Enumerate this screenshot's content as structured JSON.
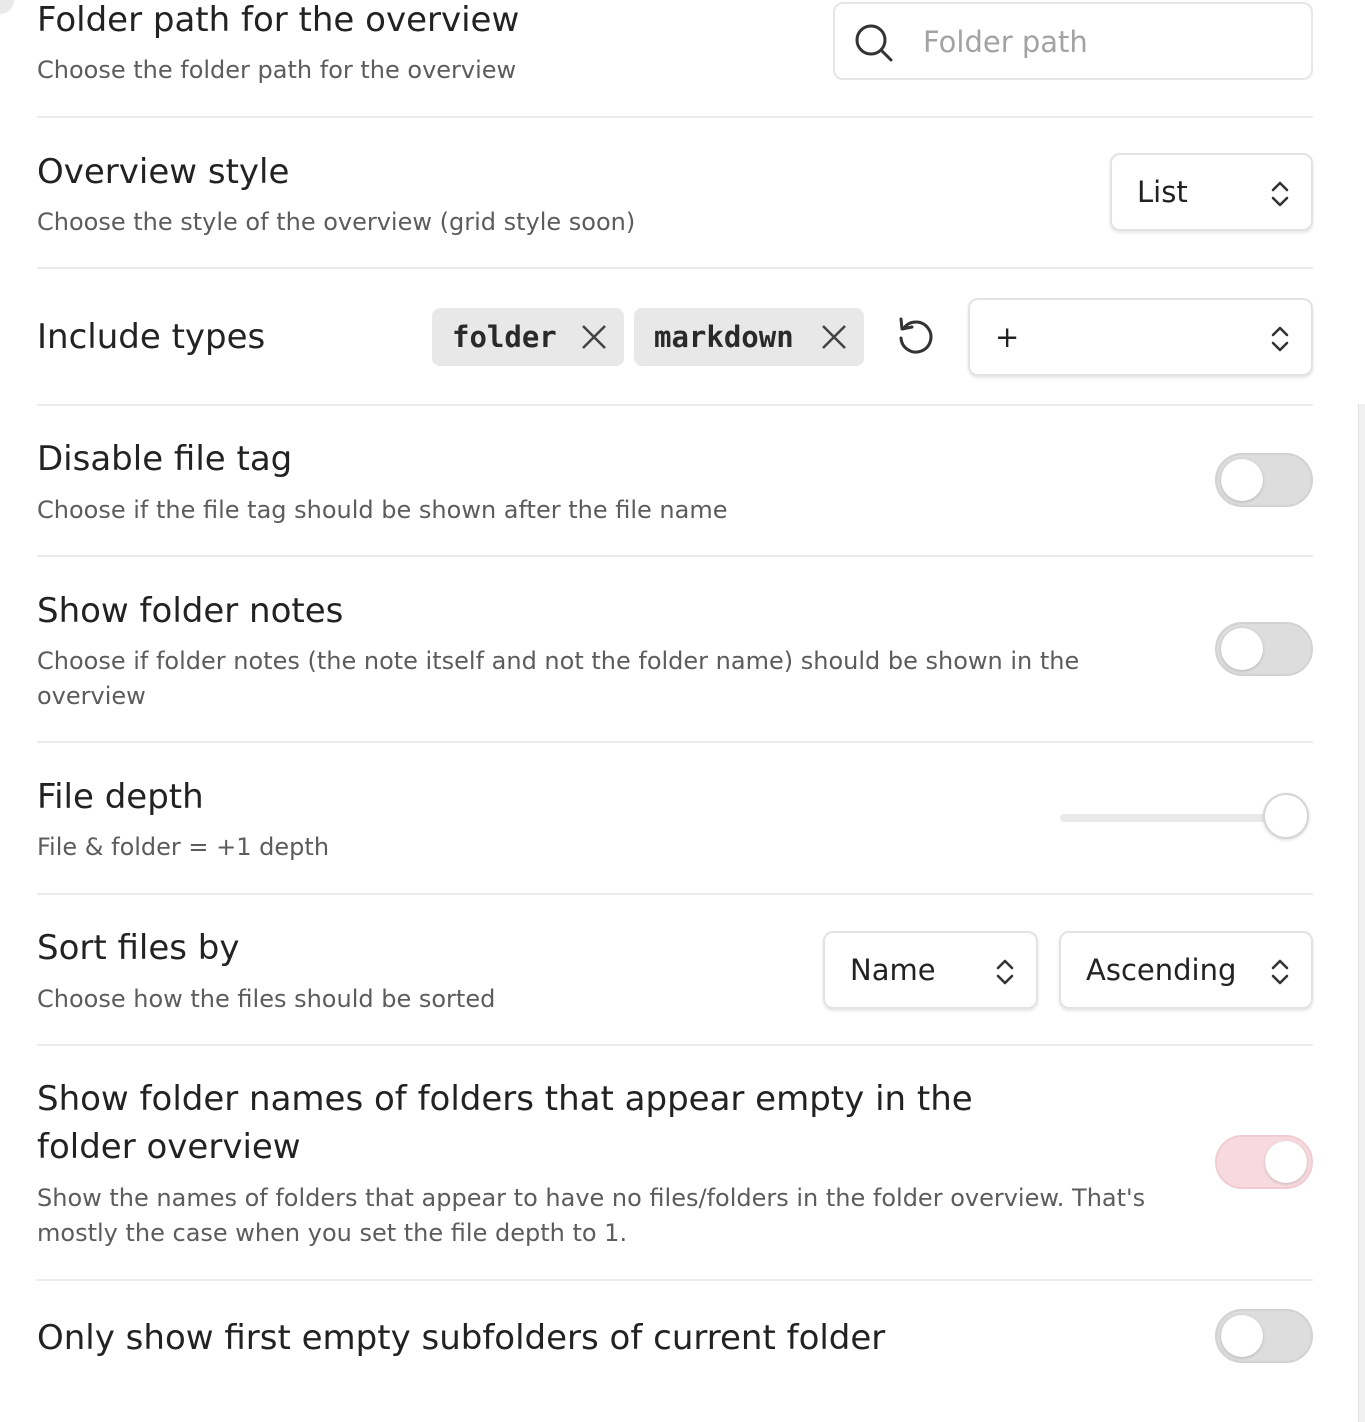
{
  "settings": {
    "folder_path": {
      "name": "Folder path for the overview",
      "desc": "Choose the folder path for the overview",
      "input_placeholder": "Folder path",
      "input_value": "",
      "icon": "search-icon"
    },
    "overview_style": {
      "name": "Overview style",
      "desc": "Choose the style of the overview (grid style soon)",
      "selected": "List"
    },
    "include_types": {
      "name": "Include types",
      "chips": [
        "folder",
        "markdown"
      ],
      "add_label": "+",
      "reset_icon": "reset-icon"
    },
    "disable_file_tag": {
      "name": "Disable file tag",
      "desc": "Choose if the file tag should be shown after the file name",
      "enabled": false
    },
    "show_folder_notes": {
      "name": "Show folder notes",
      "desc": "Choose if folder notes (the note itself and not the folder name) should be shown in the overview",
      "enabled": false
    },
    "file_depth": {
      "name": "File depth",
      "desc": "File & folder = +1 depth",
      "slider_fraction": 1.0
    },
    "sort_files": {
      "name": "Sort files by",
      "desc": "Choose how the files should be sorted",
      "sort_by": "Name",
      "order": "Ascending"
    },
    "show_empty_folders": {
      "name": "Show folder names of folders that appear empty in the folder overview",
      "desc": "Show the names of folders that appear to have no files/folders in the folder overview. That's mostly the case when you set the file depth to 1.",
      "enabled": true
    },
    "only_first_empty": {
      "name": "Only show first empty subfolders of current folder",
      "enabled": false
    }
  },
  "colors": {
    "toggle_on": "#f6dadf",
    "toggle_off": "#dddddd",
    "divider": "#ebebeb"
  }
}
